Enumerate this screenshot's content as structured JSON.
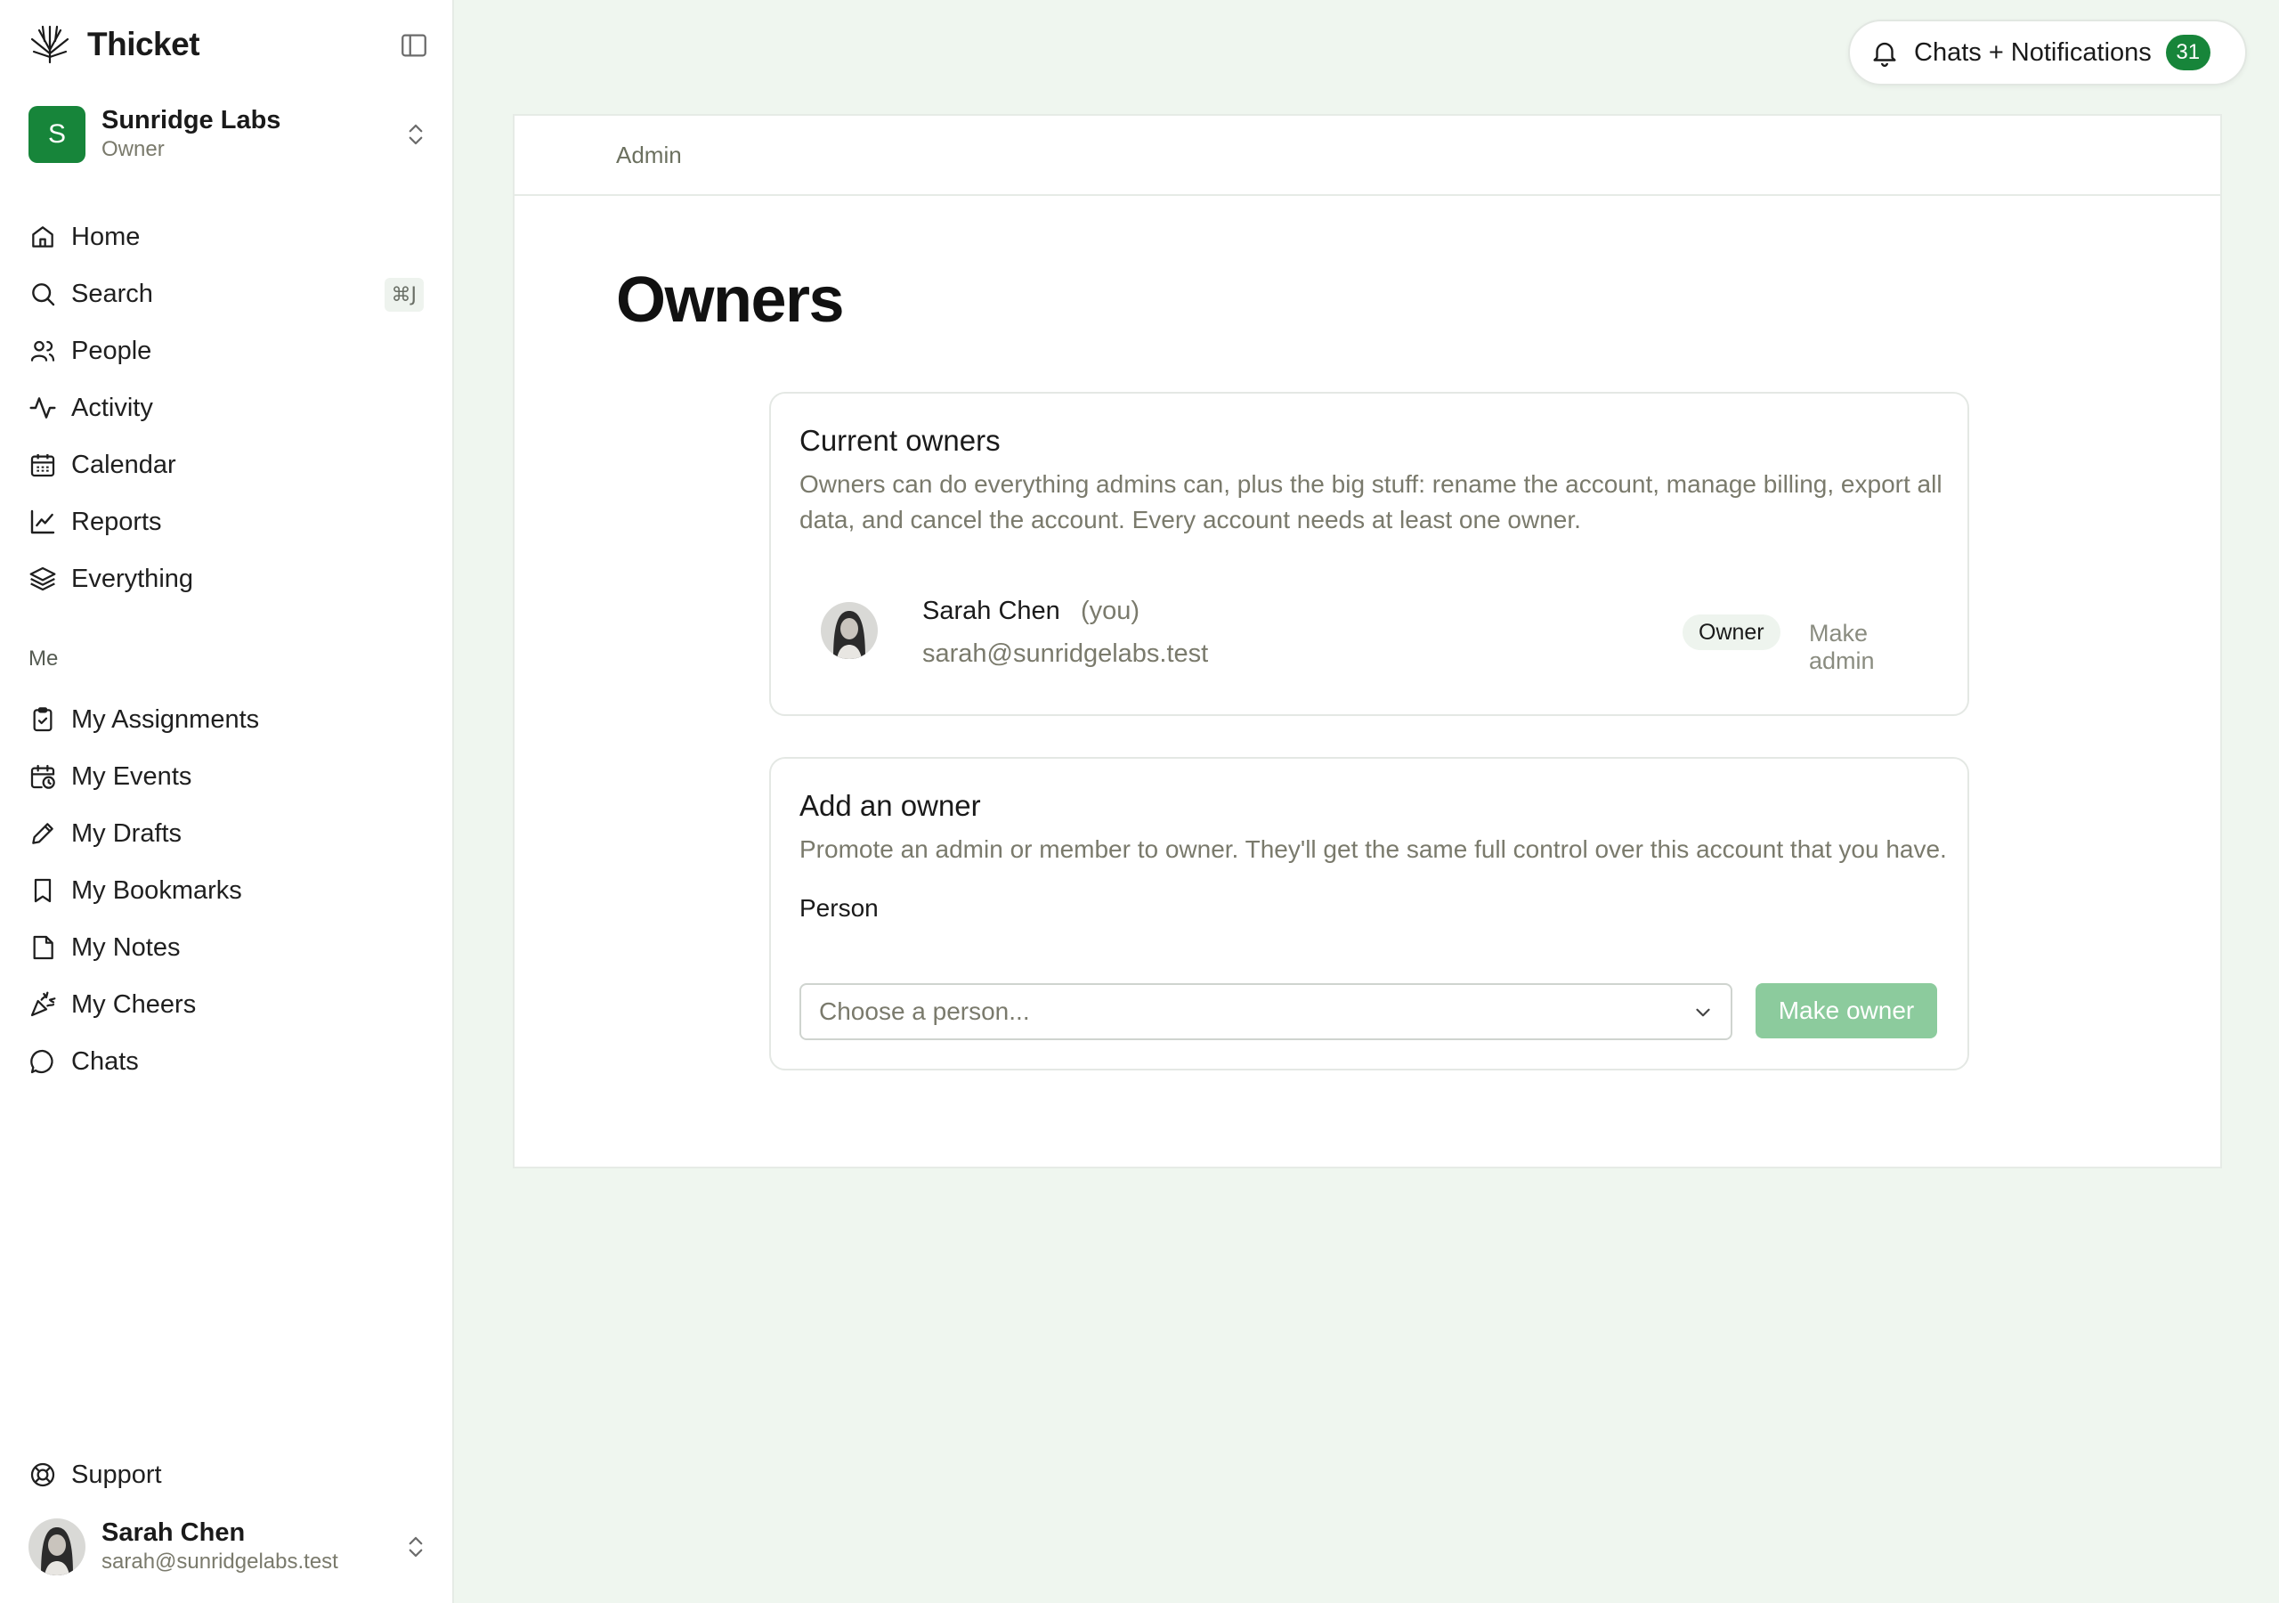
{
  "brand": {
    "name": "Thicket"
  },
  "workspace": {
    "initial": "S",
    "name": "Sunridge Labs",
    "role": "Owner"
  },
  "nav": [
    {
      "label": "Home",
      "icon": "home-icon"
    },
    {
      "label": "Search",
      "icon": "search-icon",
      "shortcut": "⌘J"
    },
    {
      "label": "People",
      "icon": "people-icon"
    },
    {
      "label": "Activity",
      "icon": "activity-icon"
    },
    {
      "label": "Calendar",
      "icon": "calendar-icon"
    },
    {
      "label": "Reports",
      "icon": "chart-icon"
    },
    {
      "label": "Everything",
      "icon": "layers-icon"
    }
  ],
  "me_section": {
    "label": "Me",
    "items": [
      {
        "label": "My Assignments",
        "icon": "clipboard-check-icon"
      },
      {
        "label": "My Events",
        "icon": "calendar-clock-icon"
      },
      {
        "label": "My Drafts",
        "icon": "pencil-icon"
      },
      {
        "label": "My Bookmarks",
        "icon": "bookmark-icon"
      },
      {
        "label": "My Notes",
        "icon": "note-icon"
      },
      {
        "label": "My Cheers",
        "icon": "party-popper-icon"
      },
      {
        "label": "Chats",
        "icon": "chat-bubble-icon"
      }
    ]
  },
  "support": {
    "label": "Support"
  },
  "user": {
    "name": "Sarah Chen",
    "email": "sarah@sunridgelabs.test"
  },
  "notifications": {
    "label": "Chats + Notifications",
    "count": "31"
  },
  "main": {
    "breadcrumb": "Admin",
    "title": "Owners",
    "current_owners": {
      "title": "Current owners",
      "description": "Owners can do everything admins can, plus the big stuff: rename the account, manage billing, export all data, and cancel the account. Every account needs at least one owner.",
      "owners": [
        {
          "name": "Sarah Chen",
          "you": "(you)",
          "email": "sarah@sunridgelabs.test",
          "badge": "Owner",
          "action": "Make admin"
        }
      ]
    },
    "add_owner": {
      "title": "Add an owner",
      "description": "Promote an admin or member to owner. They'll get the same full control over this account that you have.",
      "field_label": "Person",
      "placeholder": "Choose a person...",
      "button": "Make owner"
    }
  },
  "colors": {
    "accent": "#17853a",
    "accent_disabled": "#8ccb9d",
    "background": "#eff6ef"
  }
}
